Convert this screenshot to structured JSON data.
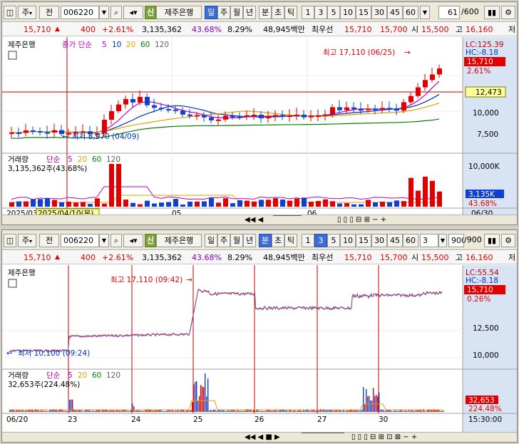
{
  "top": {
    "market": "주",
    "mode": "전",
    "code": "006220",
    "name": "제주은행",
    "sin": "신",
    "periods": [
      "일",
      "주",
      "월",
      "년",
      "분",
      "초",
      "틱"
    ],
    "intervals": [
      "1",
      "3",
      "5",
      "10",
      "15",
      "30",
      "45",
      "60"
    ],
    "count": "61",
    "count_total": "/600",
    "quote": {
      "price": "15,710",
      "arrow": "▲",
      "change": "400",
      "rate": "+2.61%",
      "volume": "3,135,362",
      "turnover": "43.68%",
      "ratio": "8.29%",
      "amount": "48,945백만",
      "pref_label": "최우선",
      "ask": "15,710",
      "bid": "15,700",
      "open_label": "시",
      "open": "15,500",
      "high_label": "고",
      "high": "16,160",
      "low_label": "저"
    },
    "price_legend": {
      "name": "제주은행",
      "series": "종가 단순",
      "mas": [
        "5",
        "10",
        "20",
        "60",
        "120"
      ]
    },
    "vol_legend": {
      "name": "거래량",
      "series": "단순",
      "mas": [
        "5",
        "20",
        "60",
        "120"
      ],
      "value": "3,135,362주(43.68%)"
    },
    "annot_high": "최고 17,110 (06/25)",
    "annot_low": "최저 8,970 (04/09)",
    "right": {
      "lc": "LC:125.39",
      "hc": "HC:-8.18",
      "price": "15,710",
      "pct": "2.61%",
      "hline": "12,473",
      "t1": "10,000",
      "t2": "7,500",
      "vmax": "10,000K",
      "vcur": "3,135K",
      "vpct": "43.68%"
    },
    "xaxis": {
      "start": "2025/03",
      "cursor": "2025/04/10(목)",
      "m5": "05",
      "m6": "06",
      "end": "06/30"
    }
  },
  "bottom": {
    "market": "주",
    "mode": "전",
    "code": "006220",
    "name": "제주은행",
    "sin": "신",
    "periods": [
      "일",
      "주",
      "월",
      "년",
      "분",
      "초",
      "틱"
    ],
    "intervals": [
      "1",
      "3",
      "5",
      "10",
      "15",
      "30",
      "45",
      "60"
    ],
    "count": "3",
    "count_total": "900",
    "count_max": "/900",
    "quote": {
      "price": "15,710",
      "arrow": "▲",
      "change": "400",
      "rate": "+2.61%",
      "volume": "3,135,362",
      "turnover": "43.68%",
      "ratio": "8.29%",
      "amount": "48,945백만",
      "pref_label": "최우선",
      "ask": "15,710",
      "bid": "15,700",
      "open_label": "시",
      "open": "15,500",
      "high_label": "고",
      "high": "16,160",
      "low_label": "저"
    },
    "price_legend": {
      "name": "제주은행"
    },
    "vol_legend": {
      "name": "거래량",
      "series": "단순",
      "mas": [
        "5",
        "20",
        "60",
        "120"
      ],
      "value": "32,653주(224.48%)"
    },
    "annot_high": "최고 17,110 (09:42)",
    "annot_low": "최저 10,100 (09:24)",
    "right": {
      "lc": "LC:55.54",
      "hc": "HC:-8.18",
      "price": "15,710",
      "pct": "0.26%",
      "t1": "12,500",
      "t2": "10,000",
      "vcur": "32,653",
      "vpct": "224.48%"
    },
    "xaxis": {
      "d0": "06/20",
      "d1": "23",
      "d2": "24",
      "d3": "25",
      "d4": "26",
      "d5": "27",
      "d6": "30",
      "end": "15:30:00"
    }
  },
  "colors": {
    "up": "#e00000",
    "down": "#1040d0",
    "ma5": "#c000c0",
    "ma10": "#0030c0",
    "ma20": "#e0a000",
    "ma60": "#008000",
    "ma120": "#606060"
  }
}
